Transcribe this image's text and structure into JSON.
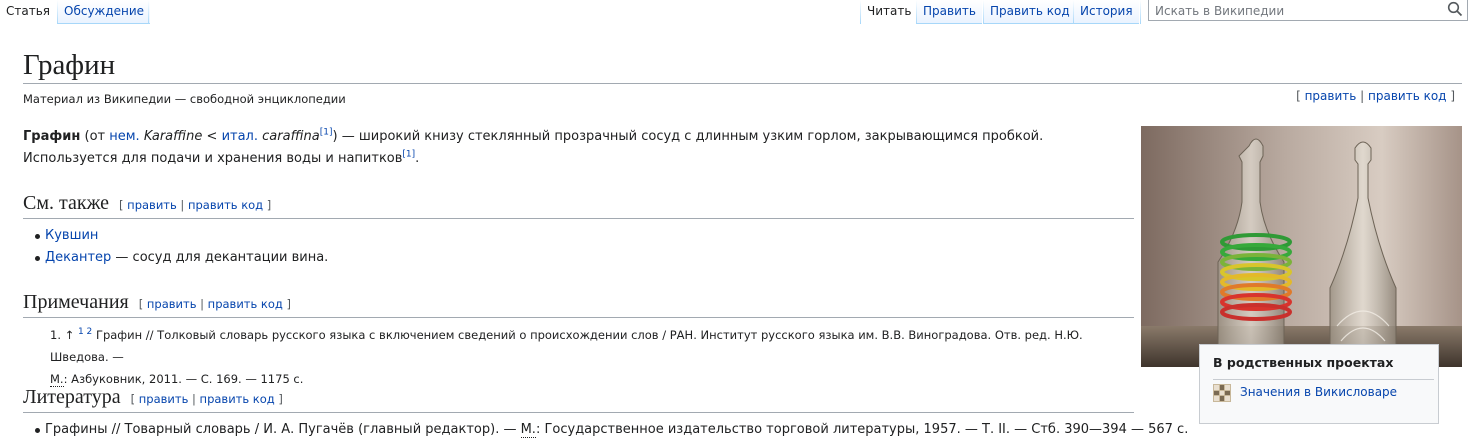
{
  "tabs": {
    "article": "Статья",
    "talk": "Обсуждение",
    "read": "Читать",
    "edit": "Править",
    "edit_source": "Править код",
    "history": "История"
  },
  "search": {
    "placeholder": "Искать в Википедии",
    "icon": "search-icon"
  },
  "page": {
    "title": "Графин",
    "site_sub": "Материал из Википедии — свободной энциклопедии",
    "edit_links": {
      "open": "[",
      "edit": "править",
      "sep": "|",
      "edit_source": "править код",
      "close": "]"
    }
  },
  "lead": {
    "term": "Графин",
    "p_open": " (от ",
    "lang1": "нем.",
    "word1": "Karaffine",
    "lt": " < ",
    "lang2": "итал.",
    "word2": "caraffina",
    "ref": "[1]",
    "text1": ") — широкий книзу стеклянный прозрачный сосуд с длинным узким горлом, закрывающимся пробкой. Используется для подачи и хранения воды и напитков",
    "ref2": "[1]",
    "end": "."
  },
  "sections": {
    "see_also": {
      "title": "См. также",
      "items": [
        {
          "link": "Кувшин",
          "text": ""
        },
        {
          "link": "Декантер",
          "text": " — сосуд для декантации вина."
        }
      ]
    },
    "notes": {
      "title": "Примечания",
      "ref_number": "1.",
      "backlink": "↑",
      "backlink_a": "1",
      "backlink_b": "2",
      "ref_text_1": "Графин // Толковый словарь русского языка с включением сведений о происхождении слов / РАН. Институт русского языка им. В.В. Виноградова. Отв. ред. Н.Ю. Шведова. —",
      "ref_city": "М.",
      "ref_text_2": ": Азбуковник, 2011. — С. 169. — 1175 с."
    },
    "literature": {
      "title": "Литература",
      "item_text_1": "Графины // Товарный словарь / И. А. Пугачёв (главный редактор). —",
      "item_city": "М.",
      "item_text_2": ": Государственное издательство торговой литературы, 1957. — Т. II. — Стб. 390—394 — 567 с."
    }
  },
  "sister_projects": {
    "title": "В родственных проектах",
    "items": [
      {
        "label": "Значения в Викисловаре",
        "icon": "wiktionary-icon"
      }
    ]
  },
  "colors": {
    "link": "#0645ad",
    "text": "#202122",
    "border": "#a2a9b1"
  }
}
